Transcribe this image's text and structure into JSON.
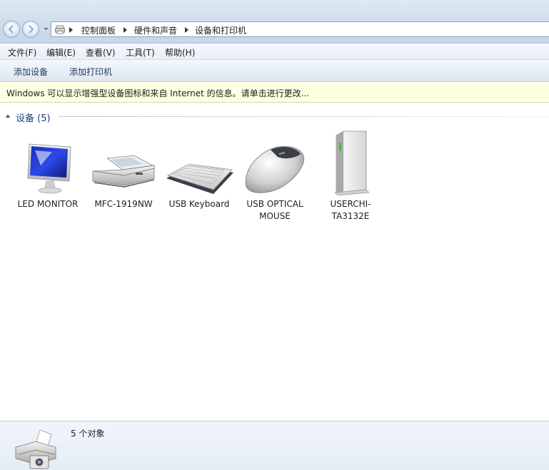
{
  "address": {
    "crumbs": [
      "控制面板",
      "硬件和声音",
      "设备和打印机"
    ]
  },
  "menu": {
    "items": [
      "文件(F)",
      "编辑(E)",
      "查看(V)",
      "工具(T)",
      "帮助(H)"
    ]
  },
  "commands": {
    "add_device": "添加设备",
    "add_printer": "添加打印机"
  },
  "infobar": {
    "text": "Windows 可以显示增强型设备图标和来自 Internet 的信息。请单击进行更改..."
  },
  "group": {
    "title": "设备 (5)"
  },
  "devices": [
    {
      "label": "LED MONITOR",
      "icon": "monitor-icon"
    },
    {
      "label": "MFC-1919NW",
      "icon": "scanner-printer-icon"
    },
    {
      "label": "USB Keyboard",
      "icon": "keyboard-icon"
    },
    {
      "label": "USB OPTICAL MOUSE",
      "icon": "mouse-icon"
    },
    {
      "label": "USERCHI-TA3132E",
      "icon": "computer-tower-icon"
    }
  ],
  "details": {
    "count": "5 个对象",
    "icon": "devices-printers-icon"
  }
}
